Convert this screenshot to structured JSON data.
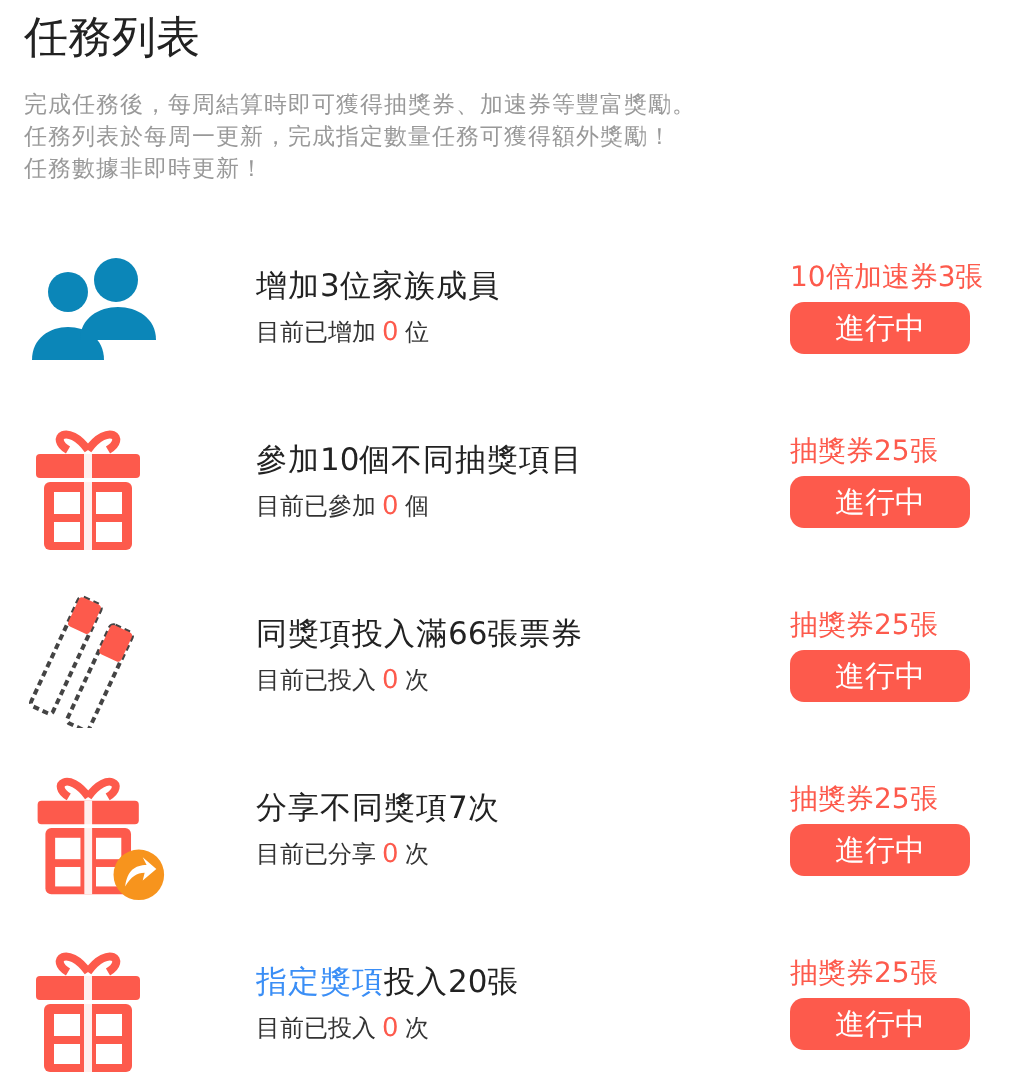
{
  "header": {
    "title": "任務列表",
    "description": [
      "完成任務後，每周結算時即可獲得抽獎券、加速券等豐富獎勵。",
      "任務列表於每周一更新，完成指定數量任務可獲得額外獎勵！",
      "任務數據非即時更新！"
    ]
  },
  "tasks": [
    {
      "kind": "people",
      "title": "增加3位家族成員",
      "progress": {
        "prefix": "目前已增加",
        "count": "0",
        "suffix": "位"
      },
      "reward": "10倍加速券3張",
      "status": "進行中"
    },
    {
      "kind": "gift",
      "title": "參加10個不同抽獎項目",
      "progress": {
        "prefix": "目前已參加",
        "count": "0",
        "suffix": "個"
      },
      "reward": "抽獎券25張",
      "status": "進行中"
    },
    {
      "kind": "tickets",
      "title": "同獎項投入滿66張票券",
      "progress": {
        "prefix": "目前已投入",
        "count": "0",
        "suffix": "次"
      },
      "reward": "抽獎券25張",
      "status": "進行中"
    },
    {
      "kind": "share",
      "title": "分享不同獎項7次",
      "progress": {
        "prefix": "目前已分享",
        "count": "0",
        "suffix": "次"
      },
      "reward": "抽獎券25張",
      "status": "進行中"
    },
    {
      "kind": "gift",
      "link": "指定獎項",
      "title": "投入20張",
      "progress": {
        "prefix": "目前已投入",
        "count": "0",
        "suffix": "次"
      },
      "reward": "抽獎券25張",
      "status": "進行中"
    }
  ]
}
